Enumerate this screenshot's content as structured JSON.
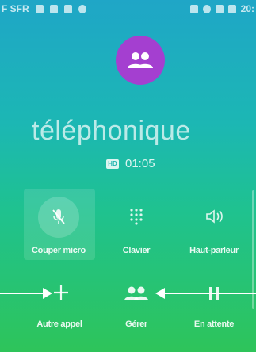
{
  "status_bar": {
    "carrier": "F SFR",
    "time": "20:"
  },
  "call": {
    "caller_name": "téléphonique",
    "hd_label": "HD",
    "duration": "01:05"
  },
  "buttons": {
    "mute": "Couper micro",
    "keypad": "Clavier",
    "speaker": "Haut-parleur",
    "add_call": "Autre appel",
    "manage": "Gérer",
    "hold": "En attente"
  },
  "colors": {
    "avatar": "#a43fd0",
    "gradient_top": "#1fa6c7",
    "gradient_bottom": "#2ec45a"
  },
  "icons": {
    "avatar": "group-icon",
    "mute": "mic-off-icon",
    "keypad": "dialpad-icon",
    "speaker": "speaker-icon",
    "add_call": "plus-icon",
    "manage": "group-icon",
    "hold": "pause-icon"
  }
}
